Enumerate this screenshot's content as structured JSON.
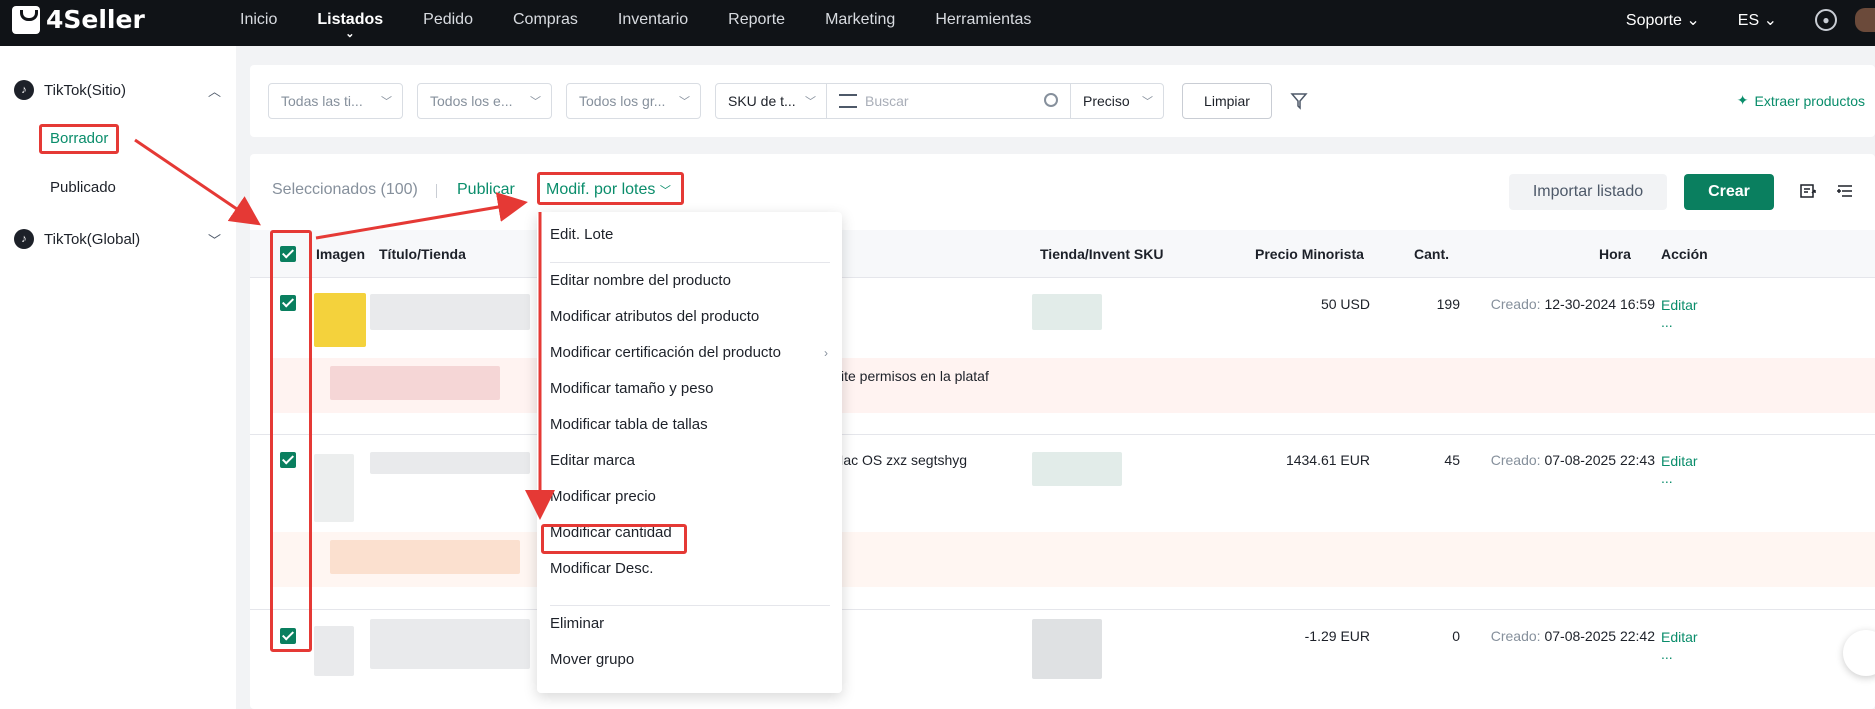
{
  "brand": "4Seller",
  "nav": {
    "items": [
      "Inicio",
      "Listados",
      "Pedido",
      "Compras",
      "Inventario",
      "Reporte",
      "Marketing",
      "Herramientas"
    ],
    "active": "Listados",
    "support": "Soporte",
    "language": "ES"
  },
  "sidebar": {
    "group1": "TikTok(Sitio)",
    "sub1": "Borrador",
    "sub2": "Publicado",
    "group2": "TikTok(Global)"
  },
  "filters": {
    "f1": "Todas las ti...",
    "f2": "Todos los e...",
    "f3": "Todos los gr...",
    "sku_type": "SKU de t...",
    "search_placeholder": "Buscar",
    "price": "Preciso",
    "clear": "Limpiar",
    "extract": "Extraer productos"
  },
  "toolbar": {
    "selected": "Seleccionados (100)",
    "publish": "Publicar",
    "batch": "Modif. por lotes",
    "import": "Importar listado",
    "create": "Crear"
  },
  "table": {
    "headers": {
      "image": "Imagen",
      "title": "Título/Tienda",
      "store_sku": "Tienda/Invent SKU",
      "price": "Precio Minorista",
      "qty": "Cant.",
      "time": "Hora",
      "action": "Acción"
    },
    "rows": [
      {
        "price": "50 USD",
        "qty": "199",
        "created_label": "Creado:",
        "created": "12-30-2024 16:59",
        "action": "Editar",
        "more": "..."
      },
      {
        "price": "1434.61 EUR",
        "qty": "45",
        "created_label": "Creado:",
        "created": "07-08-2025 22:43",
        "action": "Editar",
        "more": "...",
        "title_fragment": "0 Mac OS zxz segtshyg"
      },
      {
        "price": "-1.29 EUR",
        "qty": "0",
        "created_label": "Creado:",
        "created": "07-08-2025 22:42",
        "action": "Editar",
        "more": "..."
      }
    ],
    "warning_fragment": "olicite permisos en la plataf"
  },
  "dropdown": {
    "items": [
      "Edit. Lote",
      "Editar nombre del producto",
      "Modificar atributos del producto",
      "Modificar certificación del producto",
      "Modificar tamaño y peso",
      "Modificar tabla de tallas",
      "Editar marca",
      "Modificar precio",
      "Modificar cantidad",
      "Modificar Desc.",
      "Eliminar",
      "Mover grupo"
    ]
  },
  "colors": {
    "accent": "#0a7f5f",
    "link": "#0a8d6b",
    "annotation": "#e53935",
    "topbar": "#101317"
  },
  "icons": [
    "tiktok-icon",
    "chevron-up-icon",
    "chevron-down-icon",
    "search-icon",
    "filter-icon",
    "sparkle-icon",
    "export-icon",
    "columns-icon",
    "gear-icon",
    "check-icon",
    "chevron-right-icon",
    "chat-icon"
  ]
}
